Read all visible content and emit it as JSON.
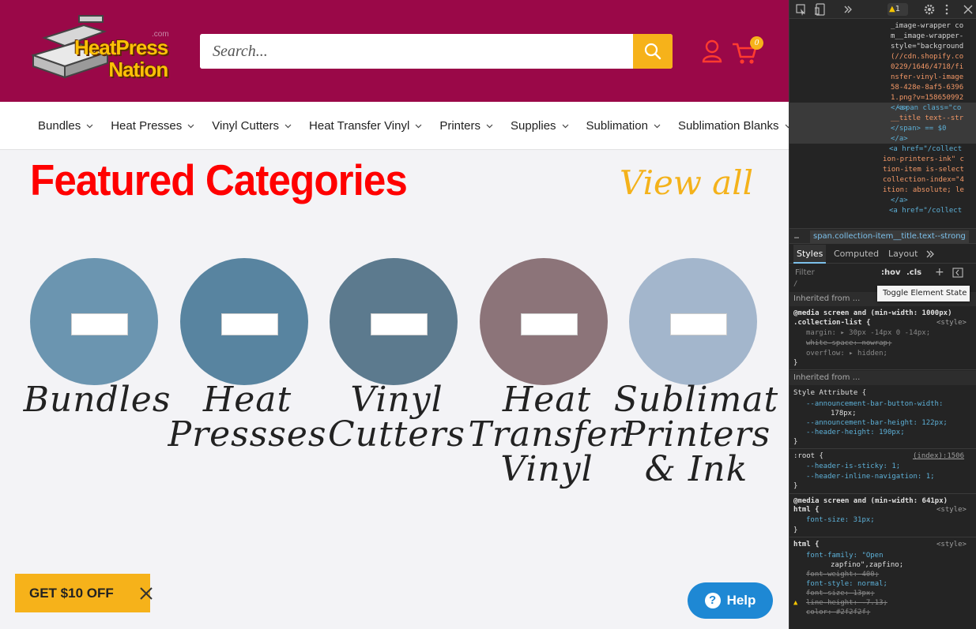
{
  "header": {
    "logo": {
      "line1": "HeatPress",
      "line2": "Nation",
      "suffix": ".com"
    },
    "search_placeholder": "Search...",
    "cart_count": "0"
  },
  "nav": {
    "items": [
      "Bundles",
      "Heat Presses",
      "Vinyl Cutters",
      "Heat Transfer Vinyl",
      "Printers",
      "Supplies",
      "Sublimation",
      "Sublimation Blanks"
    ]
  },
  "featured": {
    "title": "Featured Categories",
    "view_all": "View all"
  },
  "categories": [
    {
      "name": "Bundles",
      "color": "#6b95b0"
    },
    {
      "name": "Heat Presses",
      "color": "#5884a0"
    },
    {
      "name": "Vinyl Cutters",
      "color": "#5c7a8e"
    },
    {
      "name": "Heat Transfer Vinyl",
      "color": "#8c7479"
    },
    {
      "name": "Sublimation Printers & Ink",
      "color": "#a3b6cc"
    }
  ],
  "category_display": [
    [
      "Bundles"
    ],
    [
      "Heat",
      "Pressses"
    ],
    [
      "Vinyl",
      "Cutters"
    ],
    [
      "Heat",
      "Transfer",
      "Vinyl"
    ],
    [
      "Sublimat",
      "Printers",
      "& Ink"
    ]
  ],
  "promo": {
    "label": "GET $10 OFF"
  },
  "help": {
    "label": "Help"
  },
  "colors": {
    "header_bg": "#9a0848",
    "accent": "#f6b21a",
    "title_red": "#ff0000",
    "help_blue": "#1e88d4"
  },
  "devtools": {
    "warning_count": "1",
    "dom_lines": [
      {
        "t": "_image-wrapper co",
        "c": "txt"
      },
      {
        "t": "m__image-wrapper-",
        "c": "txt"
      },
      {
        "t": "style=\"background",
        "c": "txt"
      },
      {
        "t": "(//cdn.shopify.co",
        "c": "val"
      },
      {
        "t": "0229/1646/4718/fi",
        "c": "val"
      },
      {
        "t": "nsfer-vinyl-image",
        "c": "val"
      },
      {
        "t": "58-428e-8af5-6396",
        "c": "val"
      },
      {
        "t": "1.png?v=158650992",
        "c": "val"
      },
      {
        "t": "</a>",
        "c": "tag"
      },
      {
        "t": "<span class=\"co",
        "c": "tag"
      },
      {
        "t": "__title text--str",
        "c": "val"
      },
      {
        "t": "</span> == $0",
        "c": "tag"
      },
      {
        "t": "</a>",
        "c": "tag"
      },
      {
        "t": "<a href=\"/collect",
        "c": "tag"
      },
      {
        "t": "ion-printers-ink\" c",
        "c": "val"
      },
      {
        "t": "tion-item is-select",
        "c": "val"
      },
      {
        "t": "collection-index=\"4",
        "c": "val"
      },
      {
        "t": "ition: absolute; le",
        "c": "val"
      },
      {
        "t": "</a>",
        "c": "tag"
      },
      {
        "t": "<a href=\"/collect",
        "c": "tag"
      }
    ],
    "breadcrumb": "span.collection-item__title.text--strong",
    "tabs": [
      "Styles",
      "Computed",
      "Layout"
    ],
    "filter_placeholder": "Filter",
    "hov": ":hov",
    "cls": ".cls",
    "tooltip": "Toggle Element State",
    "inherited_1": "Inherited from ...",
    "inherited_2": "Inherited from ...",
    "rules": {
      "r1_head": "@media screen and (min-width: 1000px)",
      "r1_sel": ".collection-list {",
      "r1_src": "<style>",
      "r1_p1": "margin: ▸ 30px -14px 0 -14px;",
      "r1_p2": "white-space: nowrap;",
      "r1_p3": "overflow: ▸ hidden;",
      "r2_sel": "Style Attribute {",
      "r2_p1": "--announcement-bar-button-width:",
      "r2_p1v": "178px;",
      "r2_p2": "--announcement-bar-height: 122px;",
      "r2_p3": "--header-height: 190px;",
      "r3_sel": ":root {",
      "r3_src": "(index):1506",
      "r3_p1": "--header-is-sticky: 1;",
      "r3_p2": "--header-inline-navigation: 1;",
      "r4_head": "@media screen and (min-width: 641px)",
      "r4_sel": "html {",
      "r4_src": "<style>",
      "r4_p1": "font-size: 31px;",
      "r5_sel": "html {",
      "r5_src": "<style>",
      "r5_p1": "font-family: \"Open",
      "r5_p1b": "zapfino\",zapfino;",
      "r5_p2": "font-weight: 400;",
      "r5_p3": "font-style: normal;",
      "r5_p4": "font-size: 13px;",
      "r5_p5": "line-height: -7.13;",
      "r5_p6": "color: #2f2f2f;"
    }
  }
}
